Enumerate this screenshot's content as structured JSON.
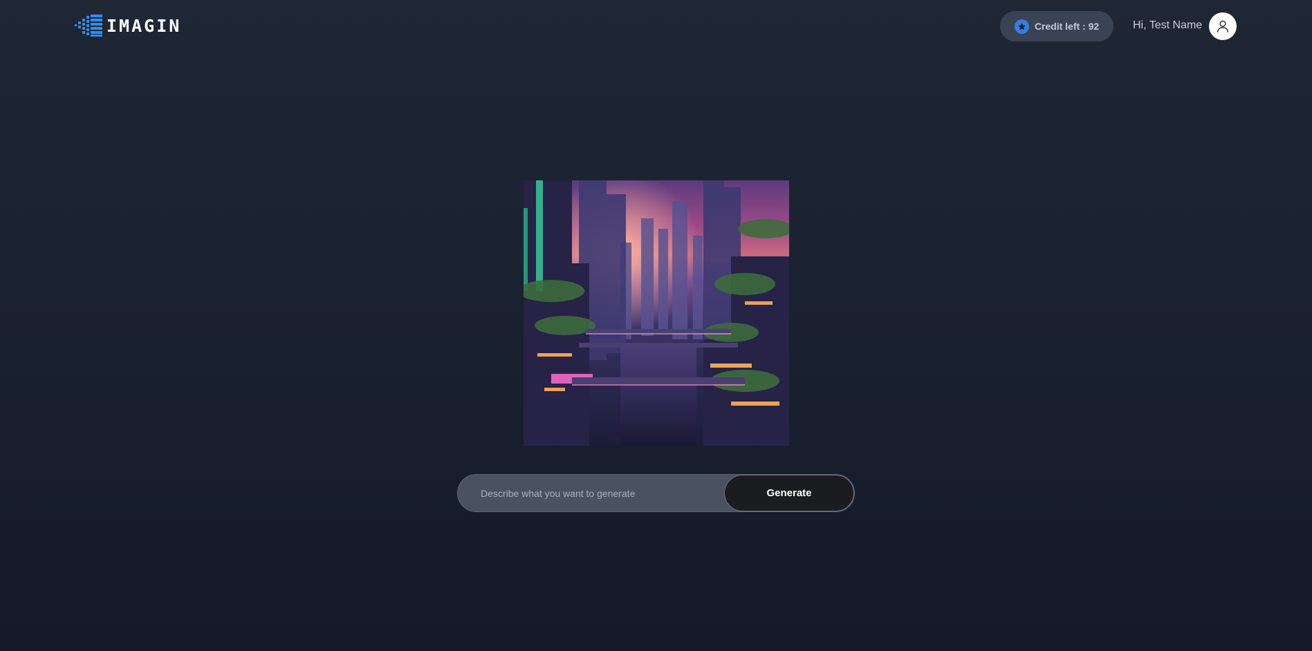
{
  "header": {
    "logo_text": "IMAGIN",
    "credit_label": "Credit left : 92",
    "greeting": "Hi, Test Name"
  },
  "prompt": {
    "placeholder": "Describe what you want to generate",
    "value": "",
    "generate_label": "Generate"
  },
  "colors": {
    "accent": "#2f7fe6",
    "background_top": "#1f2735",
    "background_bottom": "#141a28",
    "pill_background": "#3a4354",
    "prompt_background": "#4a5261",
    "button_background": "#1b1c1f"
  },
  "icons": {
    "logo": "pixel-logo-icon",
    "credit": "star-coin-icon",
    "avatar": "user-icon"
  }
}
